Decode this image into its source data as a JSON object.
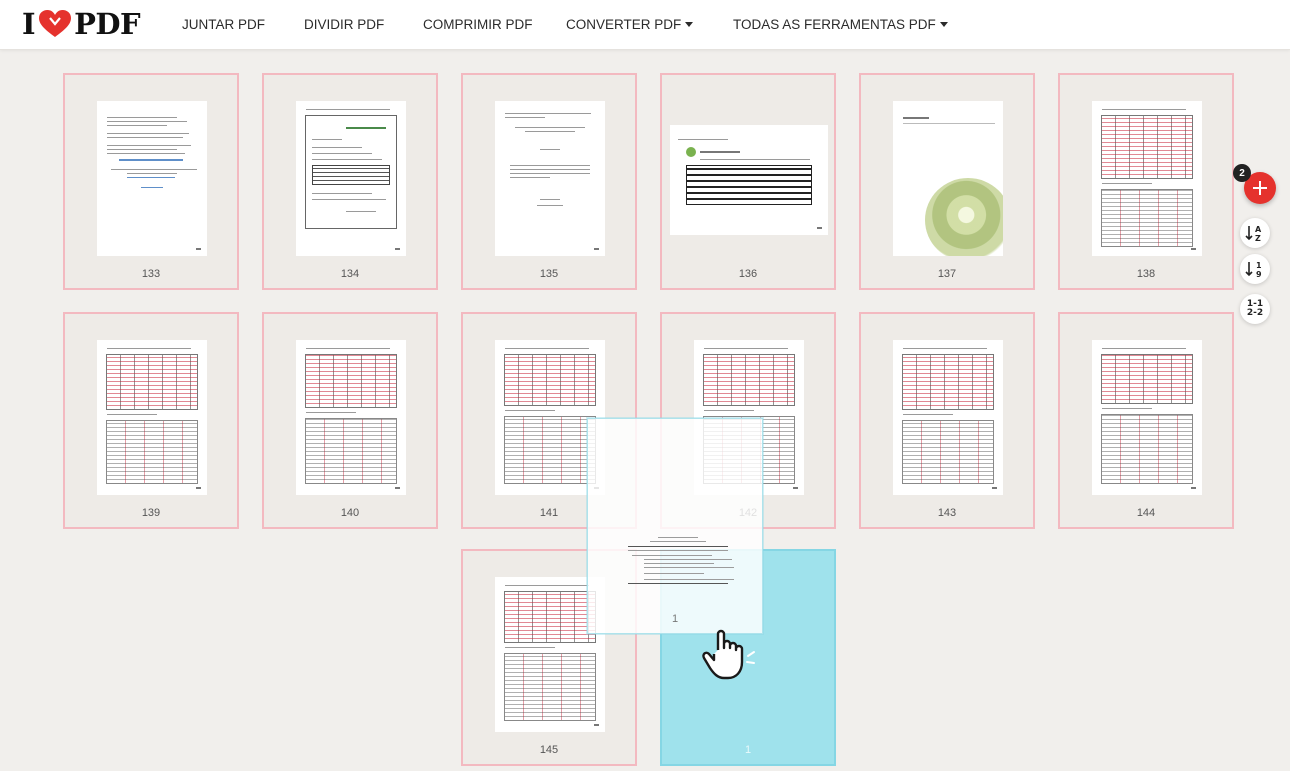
{
  "header": {
    "logo": {
      "left": "I",
      "right": "PDF",
      "heart_icon": "heart-icon",
      "heart_color": "#e5322d"
    },
    "nav": [
      {
        "label": "JUNTAR PDF",
        "dropdown": false
      },
      {
        "label": "DIVIDIR PDF",
        "dropdown": false
      },
      {
        "label": "COMPRIMIR PDF",
        "dropdown": false
      },
      {
        "label": "CONVERTER PDF",
        "dropdown": true
      },
      {
        "label": "TODAS AS FERRAMENTAS PDF",
        "dropdown": true
      }
    ]
  },
  "pages": [
    {
      "number": "133",
      "kind": "text"
    },
    {
      "number": "134",
      "kind": "form"
    },
    {
      "number": "135",
      "kind": "letter"
    },
    {
      "number": "136",
      "kind": "landscape"
    },
    {
      "number": "137",
      "kind": "cover"
    },
    {
      "number": "138",
      "kind": "table"
    },
    {
      "number": "139",
      "kind": "table"
    },
    {
      "number": "140",
      "kind": "table"
    },
    {
      "number": "141",
      "kind": "table"
    },
    {
      "number": "142",
      "kind": "table"
    },
    {
      "number": "143",
      "kind": "table"
    },
    {
      "number": "144",
      "kind": "table"
    },
    {
      "number": "145",
      "kind": "table"
    }
  ],
  "drag": {
    "dragged_label": "1",
    "placeholder_label": "1",
    "cursor_icon": "grab-hand-cursor-icon"
  },
  "tools": {
    "add_badge": "2",
    "add_icon": "plus-icon",
    "add_color": "#e5322d",
    "sort_az": {
      "top": "A",
      "bottom": "Z",
      "icon": "sort-alphabetical-icon"
    },
    "sort_num": {
      "top": "1",
      "bottom": "9",
      "icon": "sort-numeric-icon"
    },
    "reset": {
      "line1": "1-1",
      "line2": "2-2",
      "icon": "reset-order-icon"
    }
  },
  "colors": {
    "card_border": "#f3b9c0",
    "drop_placeholder": "#9fe2ec",
    "background": "#f1efec"
  }
}
